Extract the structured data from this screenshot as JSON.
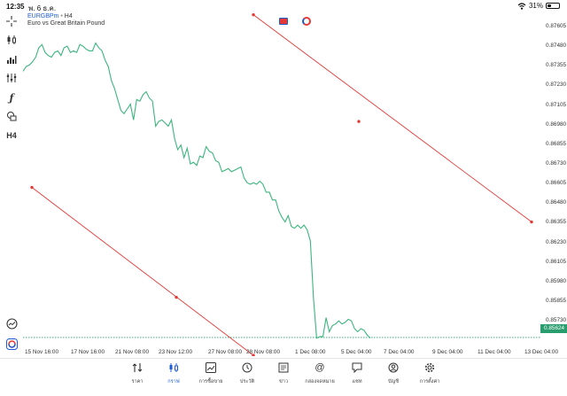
{
  "status_bar": {
    "time": "12:35",
    "date": "พ. 6 ธ.ค.",
    "wifi_icon": "wifi-icon",
    "battery_percent": "31%",
    "battery_level": 0.31
  },
  "chart": {
    "symbol": "EURGBPm",
    "separator": "•",
    "timeframe": "H4",
    "description": "Euro vs Great Britain Pound",
    "current_price": "0.85624",
    "line_color": "#3cb57e",
    "trendline_color": "#e53935",
    "price_labels": [
      "0.87605",
      "0.87480",
      "0.87355",
      "0.87230",
      "0.87105",
      "0.86980",
      "0.86855",
      "0.86730",
      "0.86605",
      "0.86480",
      "0.86355",
      "0.86230",
      "0.86105",
      "0.85980",
      "0.85855",
      "0.85730"
    ],
    "time_labels": [
      "15 Nov 16:00",
      "17 Nov 16:00",
      "21 Nov 08:00",
      "23 Nov 12:00",
      "27 Nov 08:00",
      "28 Nov 08:00",
      "1 Dec 08:00",
      "5 Dec 04:00",
      "7 Dec 04:00",
      "9 Dec 04:00",
      "11 Dec 04:00",
      "13 Dec 04:00"
    ]
  },
  "chart_data": {
    "type": "line",
    "series": [
      {
        "values": [
          0.8732,
          0.8735,
          0.8736,
          0.8738,
          0.8741,
          0.8747,
          0.8749,
          0.8744,
          0.8742,
          0.8741,
          0.8744,
          0.8745,
          0.8742,
          0.8747,
          0.8748,
          0.8744,
          0.8745,
          0.8744,
          0.8749,
          0.8748,
          0.8746,
          0.8745,
          0.8745,
          0.875,
          0.8747,
          0.8745,
          0.8739,
          0.8735,
          0.8726,
          0.8721,
          0.8714,
          0.8707,
          0.8705,
          0.8708,
          0.8711,
          0.8701,
          0.8714,
          0.8713,
          0.8717,
          0.8719,
          0.8715,
          0.8713,
          0.8697,
          0.87,
          0.8701,
          0.8699,
          0.8697,
          0.8701,
          0.8689,
          0.8682,
          0.8685,
          0.8677,
          0.8683,
          0.8673,
          0.8674,
          0.8672,
          0.8678,
          0.8677,
          0.8684,
          0.8681,
          0.868,
          0.8675,
          0.8674,
          0.8668,
          0.8669,
          0.867,
          0.8668,
          0.8669,
          0.867,
          0.8671,
          0.8664,
          0.8661,
          0.866,
          0.8661,
          0.866,
          0.8662,
          0.866,
          0.8655,
          0.8655,
          0.865,
          0.865,
          0.8643,
          0.8639,
          0.8636,
          0.864,
          0.8633,
          0.8632,
          0.8634,
          0.8632,
          0.8634,
          0.8631,
          0.8624,
          0.8587,
          0.8562,
          0.8563,
          0.8563,
          0.8575,
          0.8566,
          0.857,
          0.8571,
          0.8573,
          0.8571,
          0.8572,
          0.8574,
          0.8573,
          0.8568,
          0.8566,
          0.8568,
          0.8567,
          0.8564,
          0.8562
        ]
      }
    ],
    "x_labels": [
      "15 Nov 16:00",
      "17 Nov 16:00",
      "21 Nov 08:00",
      "23 Nov 12:00",
      "27 Nov 08:00",
      "28 Nov 08:00",
      "1 Dec 08:00",
      "5 Dec 04:00",
      "7 Dec 04:00",
      "9 Dec 04:00",
      "11 Dec 04:00",
      "13 Dec 04:00"
    ],
    "ylim": [
      0.85505,
      0.87695
    ],
    "last_price": 0.85624,
    "trendlines": [
      {
        "from": [
          "15 Nov 16:00",
          0.8658
        ],
        "mid": [
          "23 Nov 12:00",
          0.8588
        ],
        "to": [
          "28 Nov 08:00",
          0.8551
        ]
      },
      {
        "from": [
          "28 Nov 08:00",
          0.8768
        ],
        "mid": [
          "5 Dec 04:00",
          0.87
        ],
        "to": [
          "13 Dec 04:00",
          0.8636
        ]
      }
    ],
    "grid": false
  },
  "toolbar": {
    "tools": [
      "crosshair-icon",
      "candles-icon",
      "bars-icon",
      "indicators-icon",
      "function-icon",
      "objects-icon",
      "timeframe-label",
      "alert-icon",
      "trade-icon"
    ],
    "timeframe_label": "H4"
  },
  "bottom_nav": {
    "items": [
      {
        "label": "ราคา",
        "icon": "quotes-icon"
      },
      {
        "label": "กราฟ",
        "icon": "chart-candles-icon",
        "active": true
      },
      {
        "label": "การซื้อขาย",
        "icon": "trade-icon"
      },
      {
        "label": "ประวัติ",
        "icon": "history-icon"
      },
      {
        "label": "ข่าว",
        "icon": "news-icon"
      },
      {
        "label": "กล่องจดหมาย",
        "icon": "mailbox-icon"
      },
      {
        "label": "แชท",
        "icon": "chat-icon"
      },
      {
        "label": "บัญชี",
        "icon": "account-icon"
      },
      {
        "label": "การตั้งค่า",
        "icon": "settings-icon"
      }
    ]
  }
}
